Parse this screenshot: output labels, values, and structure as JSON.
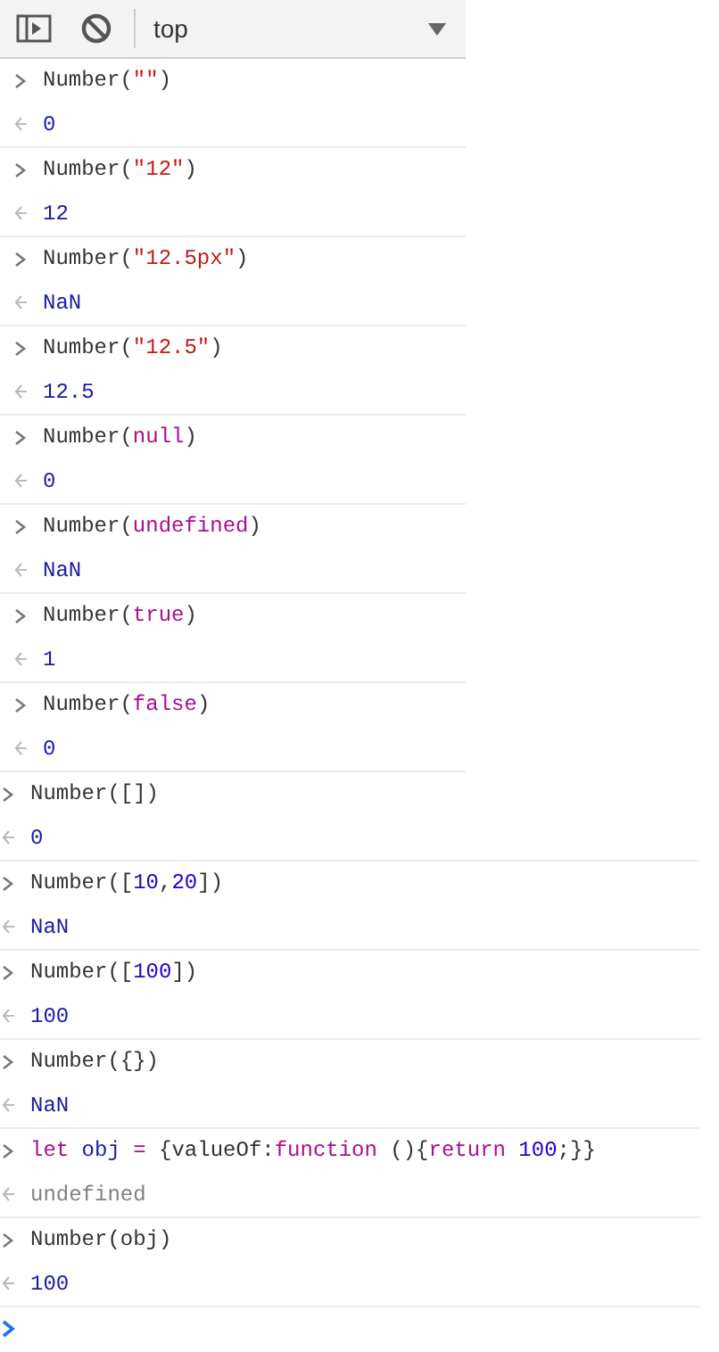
{
  "toolbar": {
    "context": "top"
  },
  "sections": [
    {
      "kind": "inset",
      "entries": [
        {
          "input": [
            {
              "text": "Number(",
              "kind": "plain"
            },
            {
              "text": "\"\"",
              "kind": "string"
            },
            {
              "text": ")",
              "kind": "plain"
            }
          ],
          "output": {
            "text": "0",
            "kind": "number"
          }
        },
        {
          "input": [
            {
              "text": "Number(",
              "kind": "plain"
            },
            {
              "text": "\"12\"",
              "kind": "string"
            },
            {
              "text": ")",
              "kind": "plain"
            }
          ],
          "output": {
            "text": "12",
            "kind": "number"
          }
        },
        {
          "input": [
            {
              "text": "Number(",
              "kind": "plain"
            },
            {
              "text": "\"12.5px\"",
              "kind": "string"
            },
            {
              "text": ")",
              "kind": "plain"
            }
          ],
          "output": {
            "text": "NaN",
            "kind": "number"
          }
        },
        {
          "input": [
            {
              "text": "Number(",
              "kind": "plain"
            },
            {
              "text": "\"12.5\"",
              "kind": "string"
            },
            {
              "text": ")",
              "kind": "plain"
            }
          ],
          "output": {
            "text": "12.5",
            "kind": "number"
          }
        },
        {
          "input": [
            {
              "text": "Number(",
              "kind": "plain"
            },
            {
              "text": "null",
              "kind": "keyword"
            },
            {
              "text": ")",
              "kind": "plain"
            }
          ],
          "output": {
            "text": "0",
            "kind": "number"
          }
        },
        {
          "input": [
            {
              "text": "Number(",
              "kind": "plain"
            },
            {
              "text": "undefined",
              "kind": "keyword"
            },
            {
              "text": ")",
              "kind": "plain"
            }
          ],
          "output": {
            "text": "NaN",
            "kind": "number"
          }
        },
        {
          "input": [
            {
              "text": "Number(",
              "kind": "plain"
            },
            {
              "text": "true",
              "kind": "keyword"
            },
            {
              "text": ")",
              "kind": "plain"
            }
          ],
          "output": {
            "text": "1",
            "kind": "number"
          }
        },
        {
          "input": [
            {
              "text": "Number(",
              "kind": "plain"
            },
            {
              "text": "false",
              "kind": "keyword"
            },
            {
              "text": ")",
              "kind": "plain"
            }
          ],
          "output": {
            "text": "0",
            "kind": "number"
          }
        }
      ]
    },
    {
      "kind": "flush",
      "entries": [
        {
          "input": [
            {
              "text": "Number([])",
              "kind": "plain"
            }
          ],
          "output": {
            "text": "0",
            "kind": "number"
          }
        },
        {
          "input": [
            {
              "text": "Number([",
              "kind": "plain"
            },
            {
              "text": "10",
              "kind": "number"
            },
            {
              "text": ",",
              "kind": "plain"
            },
            {
              "text": "20",
              "kind": "number"
            },
            {
              "text": "])",
              "kind": "plain"
            }
          ],
          "output": {
            "text": "NaN",
            "kind": "number"
          }
        },
        {
          "input": [
            {
              "text": "Number([",
              "kind": "plain"
            },
            {
              "text": "100",
              "kind": "number"
            },
            {
              "text": "])",
              "kind": "plain"
            }
          ],
          "output": {
            "text": "100",
            "kind": "number"
          }
        },
        {
          "input": [
            {
              "text": "Number({})",
              "kind": "plain"
            }
          ],
          "output": {
            "text": "NaN",
            "kind": "number"
          }
        },
        {
          "input": [
            {
              "text": "let",
              "kind": "keyword"
            },
            {
              "text": " obj",
              "kind": "variable"
            },
            {
              "text": " =",
              "kind": "operator"
            },
            {
              "text": " {valueOf:",
              "kind": "plain"
            },
            {
              "text": "function",
              "kind": "keyword"
            },
            {
              "text": " (){",
              "kind": "plain"
            },
            {
              "text": "return",
              "kind": "keyword"
            },
            {
              "text": " 100",
              "kind": "number"
            },
            {
              "text": ";}}",
              "kind": "plain"
            }
          ],
          "output": {
            "text": "undefined",
            "kind": "undefined"
          }
        },
        {
          "input": [
            {
              "text": "Number(obj)",
              "kind": "plain"
            }
          ],
          "output": {
            "text": "100",
            "kind": "number"
          }
        }
      ]
    }
  ]
}
